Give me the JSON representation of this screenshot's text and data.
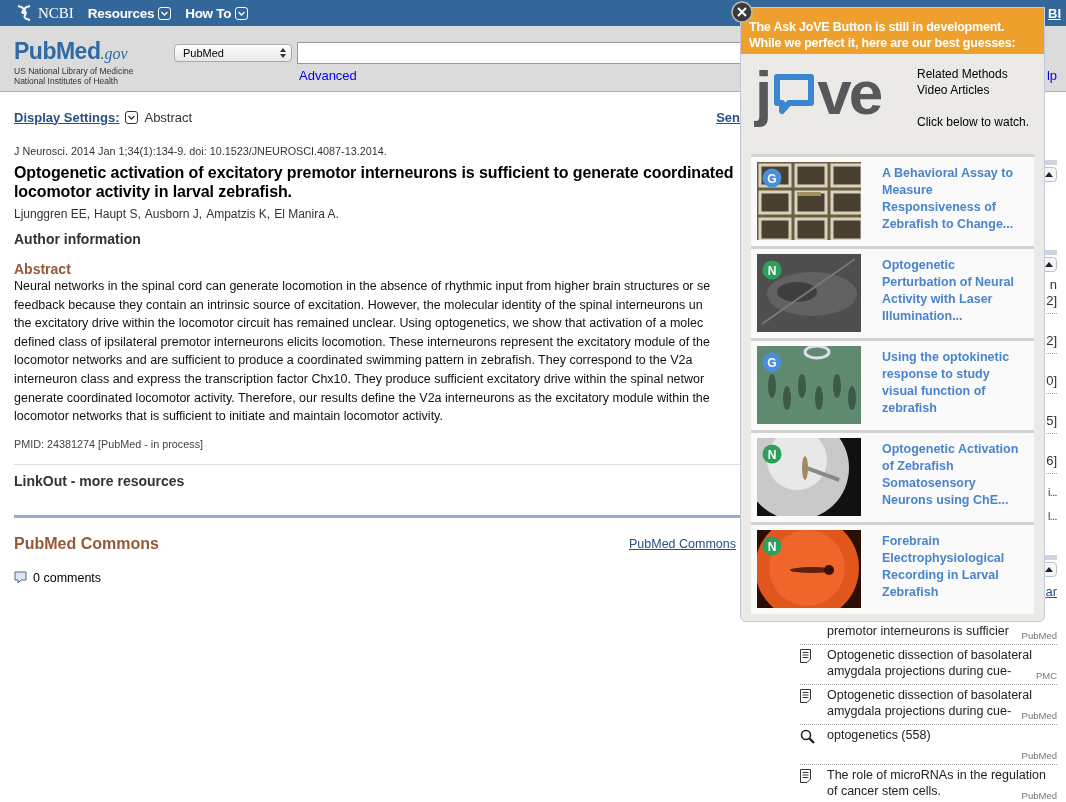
{
  "top_bar": {
    "logo": "NCBI",
    "menus": [
      {
        "label": "Resources"
      },
      {
        "label": "How To"
      }
    ],
    "account_link": "BI"
  },
  "header": {
    "logo": {
      "name": "PubMed",
      "suffix": ".gov"
    },
    "org_lines": [
      "US National Library of Medicine",
      "National Institutes of Health"
    ],
    "database": "PubMed",
    "advanced_link": "Advanced",
    "help_link": "lp"
  },
  "article": {
    "display_settings": {
      "label": "Display Settings:",
      "value": "Abstract",
      "send_to": "Sen"
    },
    "journal": "J Neurosci.",
    "citation": "2014 Jan 1;34(1):134-9. doi: 10.1523/JNEUROSCI.4087-13.2014.",
    "title": "Optogenetic activation of excitatory premotor interneurons is sufficient to generate coordinated locomotor activity in larval zebrafish.",
    "authors": [
      {
        "name": "Ljunggren EE",
        "after": ","
      },
      {
        "name": "Haupt S",
        "after": ","
      },
      {
        "name": "Ausborn J",
        "after": ","
      },
      {
        "name": "Ampatzis K",
        "after": ","
      },
      {
        "name": "El Manira A",
        "after": "."
      }
    ],
    "author_info": "Author information",
    "abstract_heading": "Abstract",
    "abstract": "Neural networks in the spinal cord can generate locomotion in the absence of rhythmic input from higher brain structures or se\nfeedback because they contain an intrinsic source of excitation. However, the molecular identity of the spinal interneurons un\nthe excitatory drive within the locomotor circuit has remained unclear. Using optogenetics, we show that activation of a molec\ndefined class of ipsilateral premotor interneurons elicits locomotion. These interneurons represent the excitatory module of the\nlocomotor networks and are sufficient to produce a coordinated swimming pattern in zebrafish. They correspond to the V2a\ninterneuron class and express the transcription factor Chx10. They produce sufficient excitatory drive within the spinal networ\ngenerate coordinated locomotor activity. Therefore, our results define the V2a interneurons as the excitatory module within the\nlocomotor networks that is sufficient to initiate and maintain locomotor activity.",
    "pmid": "PMID: 24381274 [PubMed - in process]",
    "linkout": "LinkOut - more resources"
  },
  "commons": {
    "heading": "PubMed Commons",
    "link": "PubMed Commons",
    "comments": "0 comments"
  },
  "popup": {
    "notice": "The Ask JoVE Button is still in development.\nWhile we perfect it, here are our best guesses:",
    "logo": {
      "left": "j",
      "right": "ve"
    },
    "tagline": "Related Methods\nVideo Articles",
    "instruction": "Click below to watch.",
    "articles": [
      {
        "badge": "G",
        "color": "#4a8fdb",
        "title": "A Behavioral Assay to\nMeasure\nResponsiveness of\nZebrafish to Change..."
      },
      {
        "badge": "N",
        "color": "#2e9e5b",
        "title": "Optogenetic\nPerturbation of Neural\nActivity with Laser\nIllumination..."
      },
      {
        "badge": "G",
        "color": "#4a8fdb",
        "title": "Using the optokinetic\nresponse to study\nvisual function of\nzebrafish"
      },
      {
        "badge": "N",
        "color": "#2e9e5b",
        "title": "Optogenetic Activation\nof Zebrafish\nSomatosensory\nNeurons using ChE..."
      },
      {
        "badge": "N",
        "color": "#2e9e5b",
        "title": "Forebrain\nElectrophysiological\nRecording in Larval\nZebrafish"
      }
    ]
  },
  "sidebar": {
    "sections": [
      {
        "expanded": true
      },
      {
        "expanded": true,
        "rows": [
          {
            "lines": [
              "n",
              "2]"
            ]
          },
          {
            "lines": [
              "2]"
            ]
          },
          {
            "lines": [
              "0]"
            ]
          },
          {
            "lines": [
              "5]"
            ]
          },
          {
            "lines": [
              "6]"
            ]
          }
        ],
        "more": [
          "i...",
          "l..."
        ]
      },
      {
        "expanded": true,
        "link": "ar"
      }
    ],
    "activity": [
      {
        "title": "premotor interneurons is sufficier",
        "source": "PubMed"
      },
      {
        "kind": "doc",
        "title": "Optogenetic dissection of basolateral\namygdala projections during cue-",
        "source": "PMC"
      },
      {
        "kind": "doc",
        "title": "Optogenetic dissection of basolateral\namygdala projections during cue-",
        "source": "PubMed"
      },
      {
        "kind": "search",
        "title": "optogenetics (558)",
        "source": "PubMed"
      },
      {
        "kind": "doc",
        "title": "The role of microRNAs in the regulation\nof cancer stem cells.",
        "source": "PubMed"
      }
    ]
  }
}
